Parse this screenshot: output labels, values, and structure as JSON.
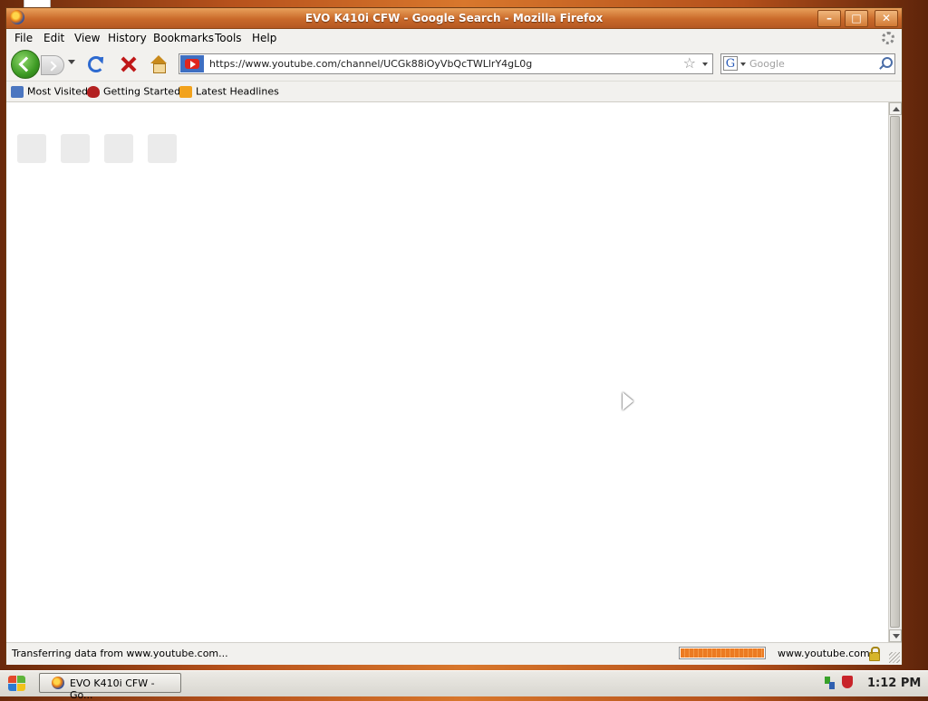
{
  "window": {
    "title": "EVO K410i CFW - Google Search - Mozilla Firefox"
  },
  "menubar": {
    "items": [
      "File",
      "Edit",
      "View",
      "History",
      "Bookmarks",
      "Tools",
      "Help"
    ]
  },
  "navigation": {
    "url": "https://www.youtube.com/channel/UCGk88iOyVbQcTWLlrY4gL0g",
    "search_placeholder": "Google",
    "search_engine_letter": "G"
  },
  "bookmarks": {
    "items": [
      "Most Visited",
      "Getting Started",
      "Latest Headlines"
    ]
  },
  "status": {
    "text": "Transferring data from www.youtube.com...",
    "host": "www.youtube.com",
    "progress": 1.0
  },
  "taskbar": {
    "task_label": "EVO K410i CFW - Go...",
    "clock": "1:12 PM"
  },
  "icons": {
    "window_controls": [
      "minimize-icon",
      "maximize-icon",
      "close-icon"
    ],
    "toolbar": [
      "back-icon",
      "forward-icon",
      "reload-icon",
      "stop-icon",
      "home-icon",
      "bookmark-star-icon",
      "search-icon"
    ]
  },
  "colors": {
    "accent": "#c9692a",
    "progress": "#ec7b22",
    "youtube": "#e0261e"
  }
}
